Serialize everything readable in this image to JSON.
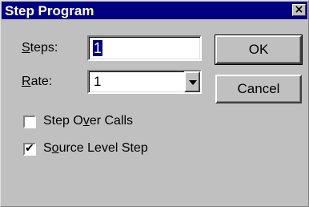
{
  "window": {
    "title": "Step Program",
    "close_glyph": "×"
  },
  "fields": {
    "steps": {
      "label_first": "S",
      "label_rest": "teps:",
      "value": "1"
    },
    "rate": {
      "label_first": "R",
      "label_rest": "ate:",
      "value": "1"
    }
  },
  "buttons": {
    "ok": "OK",
    "cancel": "Cancel"
  },
  "options": {
    "step_over": {
      "label_pre": "Step O",
      "label_u": "v",
      "label_post": "er Calls",
      "checked": false
    },
    "source_level": {
      "label_pre": "S",
      "label_u": "o",
      "label_post": "urce Level Step",
      "checked": true,
      "mark": "✔"
    }
  }
}
